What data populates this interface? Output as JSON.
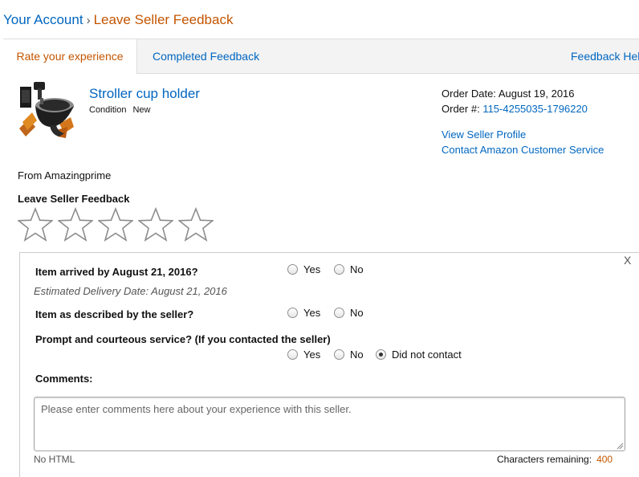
{
  "breadcrumb": {
    "root": "Your Account",
    "separator": "›",
    "current": "Leave Seller Feedback"
  },
  "tabs": [
    {
      "label": "Rate your experience",
      "active": true
    },
    {
      "label": "Completed Feedback",
      "active": false
    },
    {
      "label": "Feedback Help",
      "active": false
    }
  ],
  "product": {
    "title": "Stroller cup holder",
    "condition_label": "Condition",
    "condition_value": "New",
    "image_icon": "stroller-cup-holder-image"
  },
  "order": {
    "date_label": "Order Date:",
    "date_value": "August 19, 2016",
    "number_label": "Order #:",
    "number_value": "115-4255035-1796220",
    "view_seller_profile": "View Seller Profile",
    "contact_service": "Contact Amazon Customer Service"
  },
  "seller": {
    "from_text": "From Amazingprime"
  },
  "rating": {
    "heading": "Leave Seller Feedback",
    "stars_total": 5,
    "stars_selected": 0,
    "star_icon": "star-outline-icon"
  },
  "form": {
    "close_label": "X",
    "q1": {
      "label": "Item arrived by August 21, 2016?",
      "yes": "Yes",
      "no": "No"
    },
    "estimated_delivery": "Estimated Delivery Date:  August 21, 2016",
    "q2": {
      "label": "Item as described by the seller?",
      "yes": "Yes",
      "no": "No"
    },
    "q3": {
      "label": "Prompt and courteous service? (If you contacted the seller)",
      "yes": "Yes",
      "no": "No",
      "did_not_contact": "Did not contact",
      "selected": "did_not_contact"
    },
    "comments_label": "Comments:",
    "comments_placeholder": "Please enter comments here about your experience with this seller.",
    "comments_value": "",
    "no_html": "No HTML",
    "chars_label": "Characters remaining:",
    "chars_remaining": "400"
  },
  "colors": {
    "link": "#0066c0",
    "accent": "#c45500",
    "tab_bg": "#f3f3f3"
  }
}
